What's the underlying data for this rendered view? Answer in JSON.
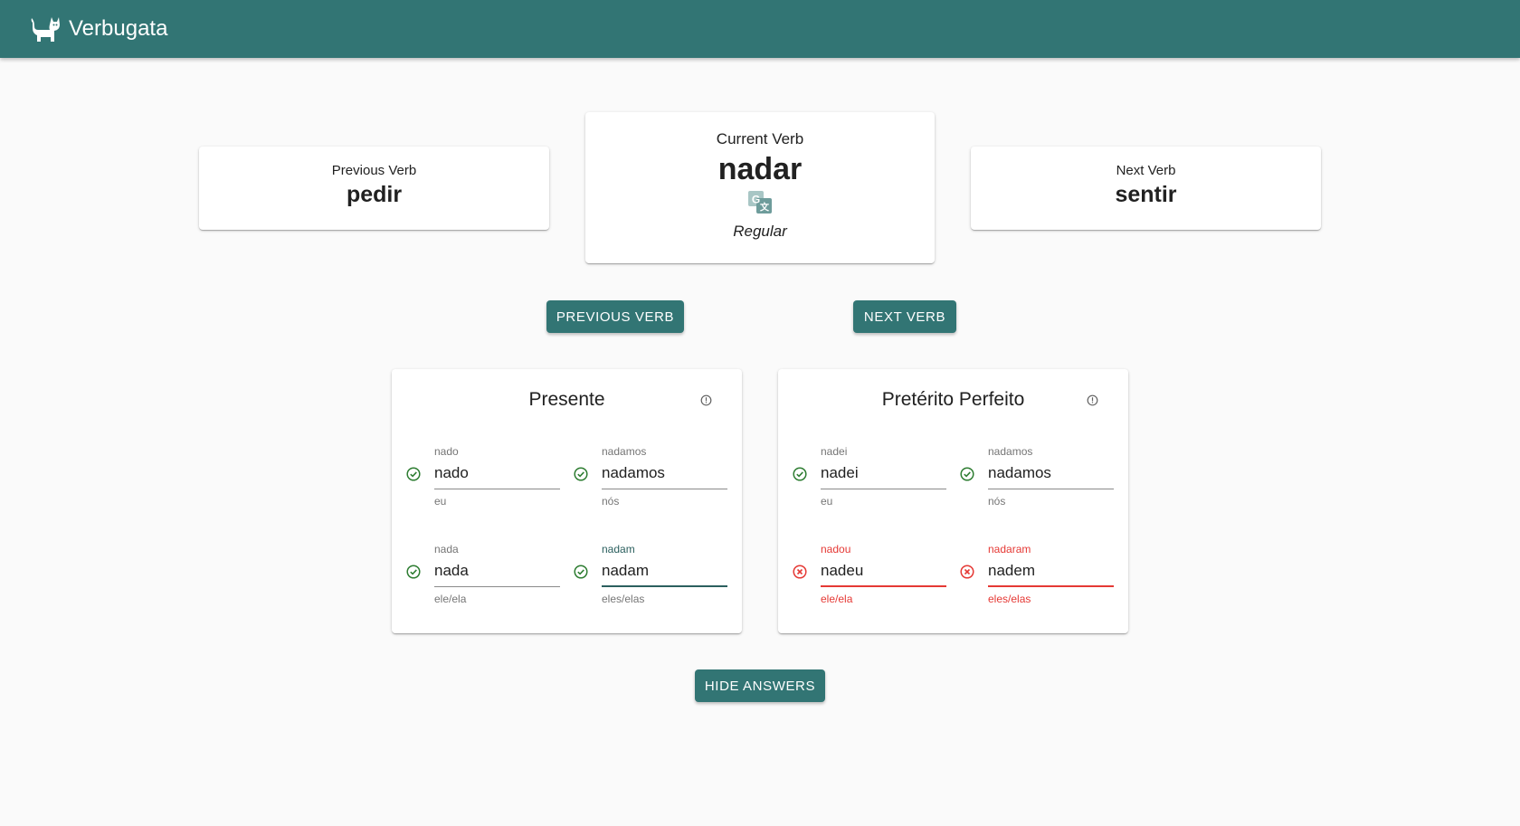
{
  "app": {
    "title": "Verbugata"
  },
  "colors": {
    "primary": "#327574",
    "success": "#2e7d32",
    "error": "#e53935"
  },
  "icons": {
    "logo": "cat-icon",
    "translate": "google-translate-icon",
    "info": "info-icon",
    "correct": "check-circle-icon",
    "incorrect": "x-circle-icon"
  },
  "previous": {
    "label": "Previous Verb",
    "verb": "pedir"
  },
  "current": {
    "label": "Current Verb",
    "verb": "nadar",
    "type": "Regular"
  },
  "next": {
    "label": "Next Verb",
    "verb": "sentir"
  },
  "buttons": {
    "previous": "PREVIOUS VERB",
    "next": "NEXT VERB",
    "hide": "HIDE ANSWERS"
  },
  "tenses": [
    {
      "title": "Presente",
      "fields": [
        {
          "answer": "nado",
          "value": "nado",
          "person": "eu",
          "correct": true
        },
        {
          "answer": "nadamos",
          "value": "nadamos",
          "person": "nós",
          "correct": true
        },
        {
          "answer": "nada",
          "value": "nada",
          "person": "ele/ela",
          "correct": true
        },
        {
          "answer": "nadam",
          "value": "nadam",
          "person": "eles/elas",
          "correct": true
        }
      ]
    },
    {
      "title": "Pretérito Perfeito",
      "fields": [
        {
          "answer": "nadei",
          "value": "nadei",
          "person": "eu",
          "correct": true
        },
        {
          "answer": "nadamos",
          "value": "nadamos",
          "person": "nós",
          "correct": true
        },
        {
          "answer": "nadou",
          "value": "nadeu",
          "person": "ele/ela",
          "correct": false
        },
        {
          "answer": "nadaram",
          "value": "nadem",
          "person": "eles/elas",
          "correct": false
        }
      ]
    }
  ]
}
